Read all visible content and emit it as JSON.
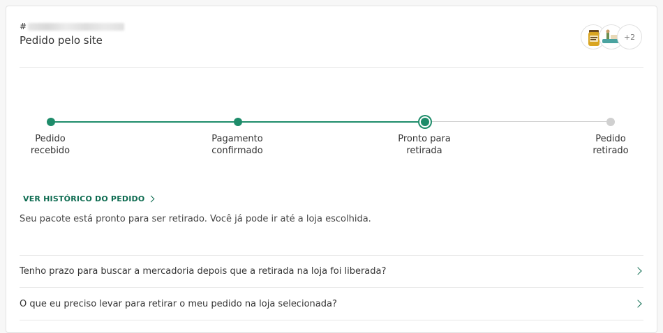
{
  "order": {
    "id_prefix": "#",
    "source": "Pedido pelo site",
    "more_items": "+2"
  },
  "tracker": {
    "steps": [
      {
        "label": "Pedido\nrecebido",
        "state": "done"
      },
      {
        "label": "Pagamento\nconfirmado",
        "state": "done"
      },
      {
        "label": "Pronto para\nretirada",
        "state": "current"
      },
      {
        "label": "Pedido\nretirado",
        "state": "pending"
      }
    ]
  },
  "history_link": "VER HISTÓRICO DO PEDIDO",
  "status_message": "Seu pacote está pronto para ser retirado. Você já pode ir até a loja escolhida.",
  "faq": [
    "Tenho prazo para buscar a mercadoria depois que a retirada na loja foi liberada?",
    "O que eu preciso levar para retirar o meu pedido na loja selecionada?"
  ],
  "colors": {
    "accent": "#1e8c6a",
    "link": "#0d6b50",
    "pending": "#d0d0d0"
  },
  "icons": {
    "link_chevron": "chevron-right-icon",
    "faq_chevron": "chevron-right-icon"
  }
}
